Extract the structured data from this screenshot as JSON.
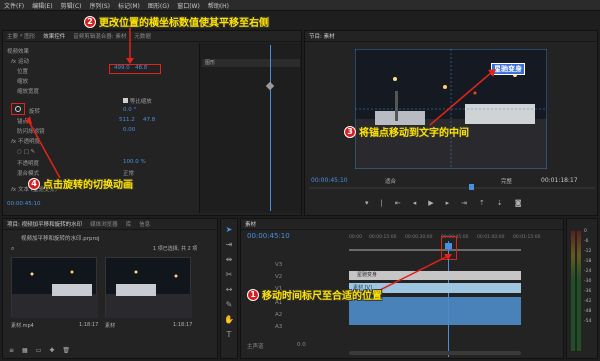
{
  "menu": [
    "文件(F)",
    "编辑(E)",
    "剪辑(C)",
    "序列(S)",
    "标记(M)",
    "图形(G)",
    "窗口(W)",
    "帮助(H)"
  ],
  "left_panel": {
    "tabs": [
      "主要 * 图形",
      "效果控件",
      "音频剪辑混合器: 素材",
      "元数据"
    ],
    "section": "视频效果",
    "motion": "运动",
    "position_label": "位置",
    "position_x": "499.0",
    "position_y": "48.8",
    "scale_label": "缩放",
    "scale_width_label": "缩放宽度",
    "uniform_label": "等比缩放",
    "rotation_label": "旋转",
    "rotation_val": "0.0 °",
    "anchor_label": "锚点",
    "anchor_x": "511.2",
    "anchor_y": "47.8",
    "antiflicker_label": "防闪烁滤镜",
    "antiflicker_val": "0.00",
    "opacity_label": "不透明度",
    "opacity_sub": "不透明度",
    "opacity_val": "100.0 %",
    "blend_label": "混合模式",
    "blend_val": "正常",
    "text_layer": "文本 (星驰变身)",
    "timecode": "00:00:45:10",
    "clip_label": "图形"
  },
  "program": {
    "title": "节目: 素材",
    "timecode_left": "00:00:45:10",
    "fit": "适合",
    "quality": "完整",
    "timecode_right": "00:01:18:17",
    "overlay_text": "星驰变身"
  },
  "project": {
    "tabs": [
      "项目: 视频加平移和旋转的水印",
      "媒体浏览器",
      "库",
      "信息"
    ],
    "file": "视频加平移和旋转的水印.prproj",
    "count": "1 项已选择, 共 2 项",
    "items": [
      {
        "name": "素材.mp4",
        "duration": "1:18:17"
      },
      {
        "name": "素材",
        "duration": "1:18:17"
      }
    ]
  },
  "timeline": {
    "tab": "素材",
    "timecode": "00:00:45:10",
    "ruler": [
      "00:00",
      "00:00:15:00",
      "00:00:30:00",
      "00:00:45:00",
      "00:01:00:00",
      "00:01:15:00",
      "00:01:30:00"
    ],
    "tracks": [
      "V3",
      "V2",
      "V1",
      "A1",
      "A2",
      "A3"
    ],
    "master": "主声道",
    "master_val": "0.0",
    "graphic_clip": "星驰变身",
    "video_clip": "素材 [V]"
  },
  "meter_labels": [
    "0",
    "-6",
    "-12",
    "-18",
    "-24",
    "-30",
    "-36",
    "-42",
    "-48",
    "-54"
  ],
  "annotations": {
    "a1": "移动时间标尺至合适的位置",
    "a2": "更改位置的横坐标数值使其平移至右侧",
    "a3": "将锚点移动到文字的中间",
    "a4": "点击旋转的切换动画",
    "n1": "1",
    "n2": "2",
    "n3": "3",
    "n4": "4"
  }
}
